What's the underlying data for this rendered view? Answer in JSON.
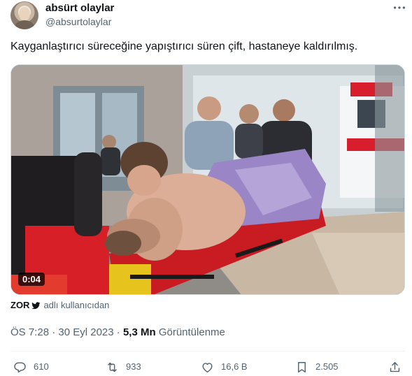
{
  "author": {
    "display_name": "absürt olaylar",
    "handle": "@absurtolaylar"
  },
  "tweet": {
    "text": "Kayganlaştırıcı süreceğine yapıştırıcı süren çift, hastaneye kaldırılmış."
  },
  "media": {
    "duration": "0:04"
  },
  "attribution": {
    "source_name": "ZOR",
    "text": "adlı kullanıcıdan"
  },
  "meta": {
    "time": "ÖS 7:28",
    "separator": "·",
    "date": "30 Eyl 2023",
    "views_count": "5,3 Mn",
    "views_label": "Görüntülenme"
  },
  "actions": {
    "replies": "610",
    "reposts": "933",
    "likes": "16,6 B",
    "bookmarks": "2.505"
  },
  "colors": {
    "text_primary": "#0f1419",
    "text_secondary": "#536471",
    "divider": "#eff3f4"
  },
  "icons": [
    "more-icon",
    "verified-badge-icon",
    "reply-icon",
    "repost-icon",
    "like-icon",
    "bookmark-icon",
    "share-icon"
  ]
}
